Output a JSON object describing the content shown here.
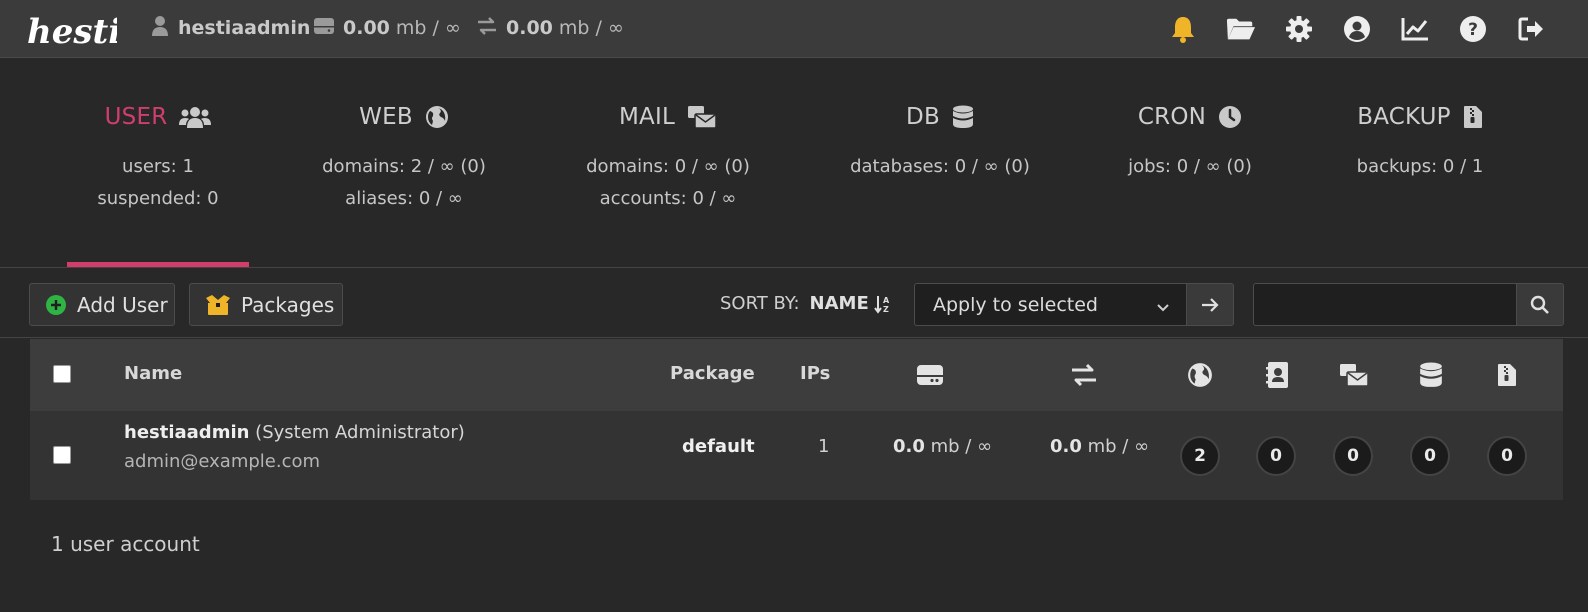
{
  "topbar": {
    "logo_text": "hestia",
    "user": "hestiaadmin",
    "disk": {
      "value": "0.00",
      "unit": "mb / ∞"
    },
    "bandwidth": {
      "value": "0.00",
      "unit": "mb / ∞"
    },
    "icons": [
      "bell-icon",
      "folder-open-icon",
      "gear-icon",
      "user-circle-icon",
      "chart-line-icon",
      "question-circle-icon",
      "sign-out-icon"
    ],
    "bell_color": "#f0b429"
  },
  "tabs": [
    {
      "title": "USER",
      "icon": "users-icon",
      "line1": "users: 1",
      "line2": "suspended: 0",
      "active": true
    },
    {
      "title": "WEB",
      "icon": "globe-icon",
      "line1": "domains: 2 / ∞ (0)",
      "line2": "aliases: 0 / ∞"
    },
    {
      "title": "MAIL",
      "icon": "mail-bulk-icon",
      "line1": "domains: 0 / ∞ (0)",
      "line2": "accounts: 0 / ∞"
    },
    {
      "title": "DB",
      "icon": "database-icon",
      "line1": "databases: 0 / ∞ (0)",
      "line2": ""
    },
    {
      "title": "CRON",
      "icon": "clock-icon",
      "line1": "jobs: 0 / ∞ (0)",
      "line2": ""
    },
    {
      "title": "BACKUP",
      "icon": "file-zipper-icon",
      "line1": "backups: 0 / 1",
      "line2": ""
    }
  ],
  "accent_color": "#d13e6c",
  "toolbar": {
    "add_user": "Add User",
    "packages": "Packages",
    "sort_by_label": "SORT BY:",
    "sort_by_value": "NAME",
    "bulk_action": "Apply to selected",
    "search_placeholder": ""
  },
  "table": {
    "headers": {
      "name": "Name",
      "package": "Package",
      "ips": "IPs"
    },
    "header_icons": [
      "hdd-icon",
      "exchange-icon",
      "globe-icon",
      "address-book-icon",
      "mail-bulk-icon",
      "database-icon",
      "file-zipper-icon"
    ],
    "rows": [
      {
        "username": "hestiaadmin",
        "role": "(System Administrator)",
        "email": "admin@example.com",
        "package": "default",
        "ips": "1",
        "disk_value": "0.0",
        "disk_unit": "mb / ∞",
        "bw_value": "0.0",
        "bw_unit": "mb / ∞",
        "web": "2",
        "dns": "0",
        "mail": "0",
        "db": "0",
        "backup": "0"
      }
    ]
  },
  "footer": "1 user account"
}
